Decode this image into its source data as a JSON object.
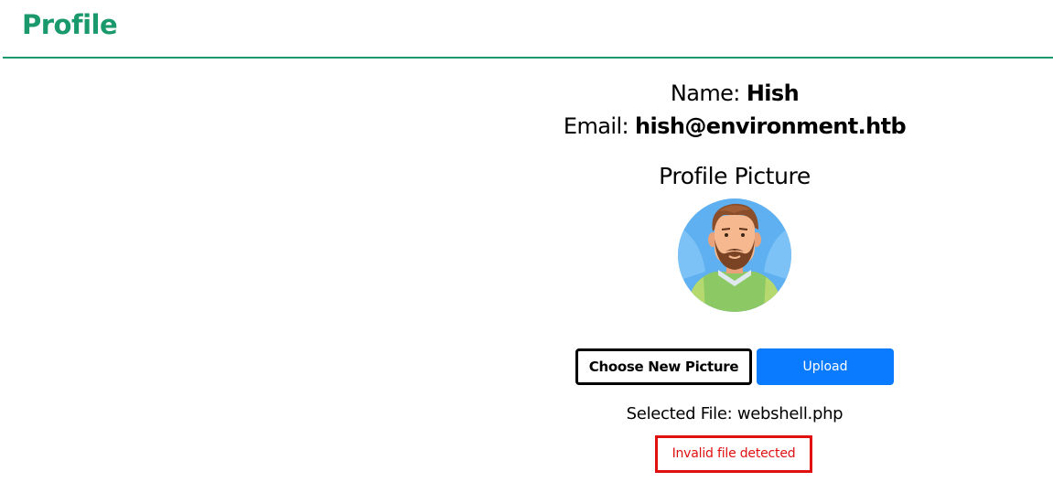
{
  "header": {
    "title": "Profile",
    "accent_color": "#1a9a6c"
  },
  "profile": {
    "name_label": "Name:",
    "name_value": "Hish",
    "email_label": "Email:",
    "email_value": "hish@environment.htb",
    "picture_heading": "Profile Picture",
    "avatar_icon": "man-avatar-icon"
  },
  "actions": {
    "choose_label": "Choose New Picture",
    "upload_label": "Upload",
    "upload_color": "#0a7bff"
  },
  "status": {
    "selected_file_label": "Selected File:",
    "selected_file_name": "webshell.php",
    "error_message": "Invalid file detected",
    "error_color": "#e01010"
  }
}
